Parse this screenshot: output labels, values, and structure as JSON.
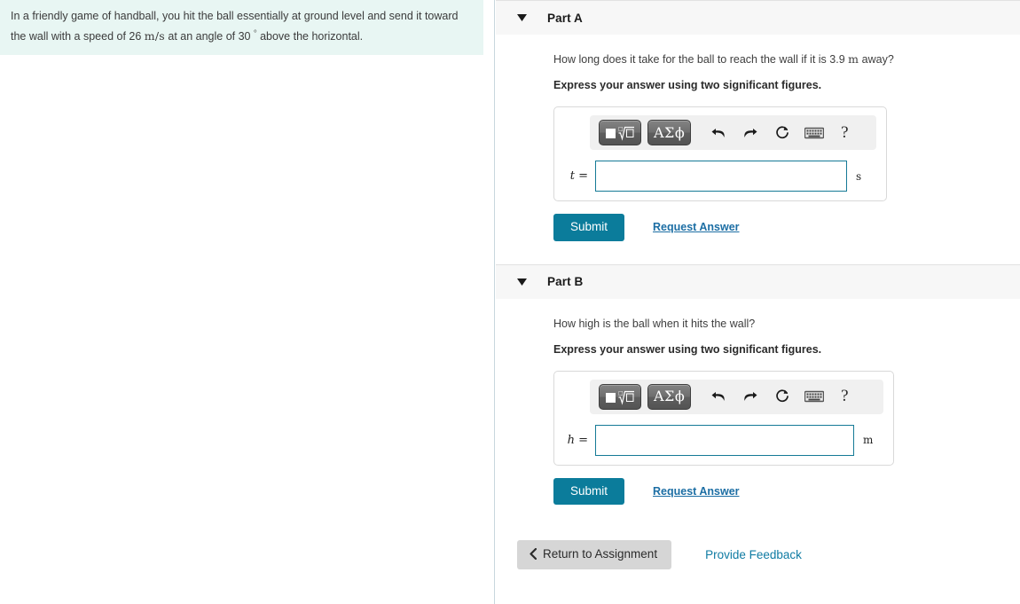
{
  "problem": {
    "text_part1": "In a friendly game of handball, you hit the ball essentially at ground level and send it toward the wall with a speed of 26 ",
    "speed_unit": "m/s",
    "text_part2": " at an angle of 30 ",
    "degree_symbol": "°",
    "text_part3": " above the horizontal.",
    "background_color": "#e8f6f3"
  },
  "toolbar": {
    "template_button_label": "math-template",
    "greek_button_label": "ΑΣϕ",
    "undo_label": "undo",
    "redo_label": "redo",
    "reset_label": "reset",
    "keyboard_label": "keyboard",
    "help_label": "?"
  },
  "parts": [
    {
      "title": "Part A",
      "question": "How long does it take for the ball to reach the wall if it is 3.9 m away?",
      "question_pre": "How long does it take for the ball to reach the wall if it is 3.9 ",
      "question_unit": "m",
      "question_post": " away?",
      "instruction": "Express your answer using two significant figures.",
      "variable": "t",
      "equals": " =",
      "value": "",
      "placeholder": "",
      "unit": "s",
      "submit_label": "Submit",
      "request_label": "Request Answer"
    },
    {
      "title": "Part B",
      "question": "How high is the ball when it hits the wall?",
      "question_pre": "How high is the ball when it hits the wall?",
      "question_unit": "",
      "question_post": "",
      "instruction": "Express your answer using two significant figures.",
      "variable": "h",
      "equals": " =",
      "value": "",
      "placeholder": "",
      "unit": "m",
      "submit_label": "Submit",
      "request_label": "Request Answer"
    }
  ],
  "footer": {
    "return_label": "Return to Assignment",
    "feedback_label": "Provide Feedback"
  },
  "colors": {
    "accent_teal": "#0b7c9b",
    "link_blue": "#1c6ea4",
    "feedback_teal": "#0f7ba3",
    "input_border": "#157a96",
    "part_header_bg": "#f7f7f7"
  }
}
